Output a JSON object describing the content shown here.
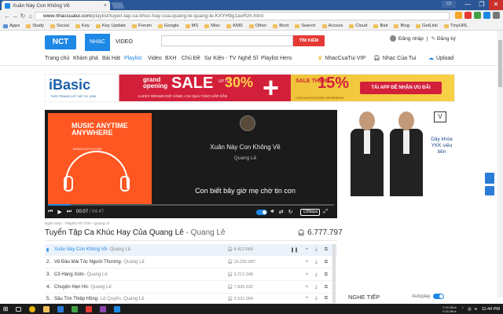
{
  "browser": {
    "tab_title": "Xuân Này Con Không Về",
    "tab_close": "×",
    "url_domain": "www.nhaccuatui.com",
    "url_path": "/playlist/tuyen-tap-ca-khuc-hay-cua-quang-le-quang-le.KXYH9g1aoRzh.html",
    "user_chip": "C3",
    "window_controls": [
      "—",
      "❐",
      "✕"
    ],
    "bookmarks": [
      "Apps",
      "Study",
      "Social",
      "Key",
      "Key Update",
      "Forum",
      "Google",
      "MS",
      "Misc",
      "KMS",
      "Other",
      "Boot",
      "Search",
      "Access",
      "Cloud",
      "Bait",
      "Blog",
      "GetLink",
      "TinyURL"
    ]
  },
  "header": {
    "logo": "NCT",
    "nav_music": "NHẠC",
    "nav_video": "VIDEO",
    "search_button": "TÌM KIẾM",
    "login": "Đăng nhập",
    "separator": "|",
    "register": "Đăng ký"
  },
  "menu": {
    "items": [
      "Trang chủ",
      "Khám phá",
      "Bài Hát",
      "Playlist",
      "Video",
      "BXH",
      "Chủ Đề",
      "Sự Kiện - TV",
      "Nghệ Sĩ",
      "Playlist Hero"
    ],
    "active_index": 3,
    "vip": "NhacCuaTui VIP",
    "my_music": "Nhạc Của Tui",
    "upload": "Upload"
  },
  "banner": {
    "brand": "iBasic",
    "brand_sub": "THỜI TRANG LÓT NỮ TỪ 1990",
    "grand": "grand",
    "opening": "opening",
    "sale": "SALE",
    "upto": "UP TO",
    "pct30": "30%",
    "lucky": "LUCKY DRAWS   GIỜ VÀNG • CH   QUÀ TẶNG HẤP DẪN",
    "sale_them": "SALE THÊM",
    "pct15": "15%",
    "cho": "CHO NGƯỜI DÙNG SHOPINESS",
    "app_button": "TẢI APP ĐỂ NHẬN ƯU ĐÃI"
  },
  "player": {
    "album_text": "MUSIC ANYTIME ANYWHERE",
    "album_url": "NHACCUATUI.COM",
    "title": "Xuân Này Con Không Về",
    "artist": "Quang Lê",
    "lyric": "Con biết bây giờ mẹ chờ tin con",
    "time_current": "00:07",
    "time_total": "/ 04:47",
    "progress": 0.08,
    "quality": "128kbps"
  },
  "ad": {
    "text": "Dây khóa YKK siêu bền",
    "logo": "V"
  },
  "breadcrumb": "Nghe nhạc  ›  Playlist Trữ Tình  ›  Quang Lê",
  "playlist": {
    "title": "Tuyển Tập Ca Khúc Hay Của Quang Lê",
    "artist": " - Quang Lê",
    "listens": "6.777.797"
  },
  "tracks": [
    {
      "num": "1.",
      "name": "Xuân Này Con Không Về",
      "artist": " - Quang Lê",
      "count": "4.412.666"
    },
    {
      "num": "2.",
      "name": "Về Đâu Mái Tóc Người Thương",
      "artist": " - Quang Lê",
      "count": "16.232.987"
    },
    {
      "num": "3.",
      "name": "Cô Hàng Xóm",
      "artist": " - Quang Lê",
      "count": "3.212.348"
    },
    {
      "num": "4.",
      "name": "Chuyện Hẹn Hò",
      "artist": " - Quang Lê",
      "count": "7.835.632"
    },
    {
      "num": "5.",
      "name": "Sầu Tím Thiệp Hồng",
      "artist": " - Lệ Quyên, Quang Lê",
      "count": "2.531.094"
    }
  ],
  "next": {
    "title": "NGHE TIẾP",
    "autoplay": "Autoplay"
  },
  "taskbar": {
    "net_up": "0.00 Mb/s",
    "net_down": "0.00 Mb/s",
    "clock": "11:44 PM"
  }
}
